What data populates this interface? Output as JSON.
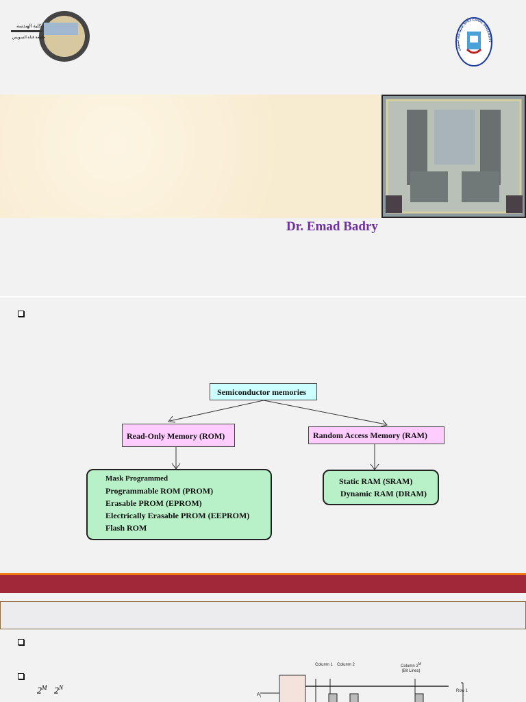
{
  "slide1": {
    "author": "Dr. Emad Badry",
    "faculty_logo_text": "كلية الهندسة جامعة قناة السويس",
    "university_logo_text": "جامعة قناة السويس SUEZ CANAL UNIVERSITY"
  },
  "slide2": {
    "diagram": {
      "root": "Semiconductor memories",
      "rom": {
        "label": "Read-Only Memory (ROM)",
        "items": [
          "Mask Programmed",
          "Programmable ROM (PROM)",
          "Erasable PROM (EPROM)",
          "Electrically Erasable PROM (EEPROM)",
          "Flash ROM"
        ]
      },
      "ram": {
        "label": "Random Access Memory (RAM)",
        "items": [
          "Static RAM (SRAM)",
          "Dynamic RAM (DRAM)"
        ]
      }
    }
  },
  "slide3": {
    "formula": {
      "a": "2",
      "a_exp": "M",
      "b": "2",
      "b_exp": "N"
    },
    "circuit": {
      "col1": "Column 1",
      "col2": "Column 2",
      "col3": "Column 2",
      "col3_exp": "M",
      "bitlines": "(Bit Lines)",
      "row1": "Row 1",
      "addr": "A",
      "addr_sub": "i"
    }
  }
}
